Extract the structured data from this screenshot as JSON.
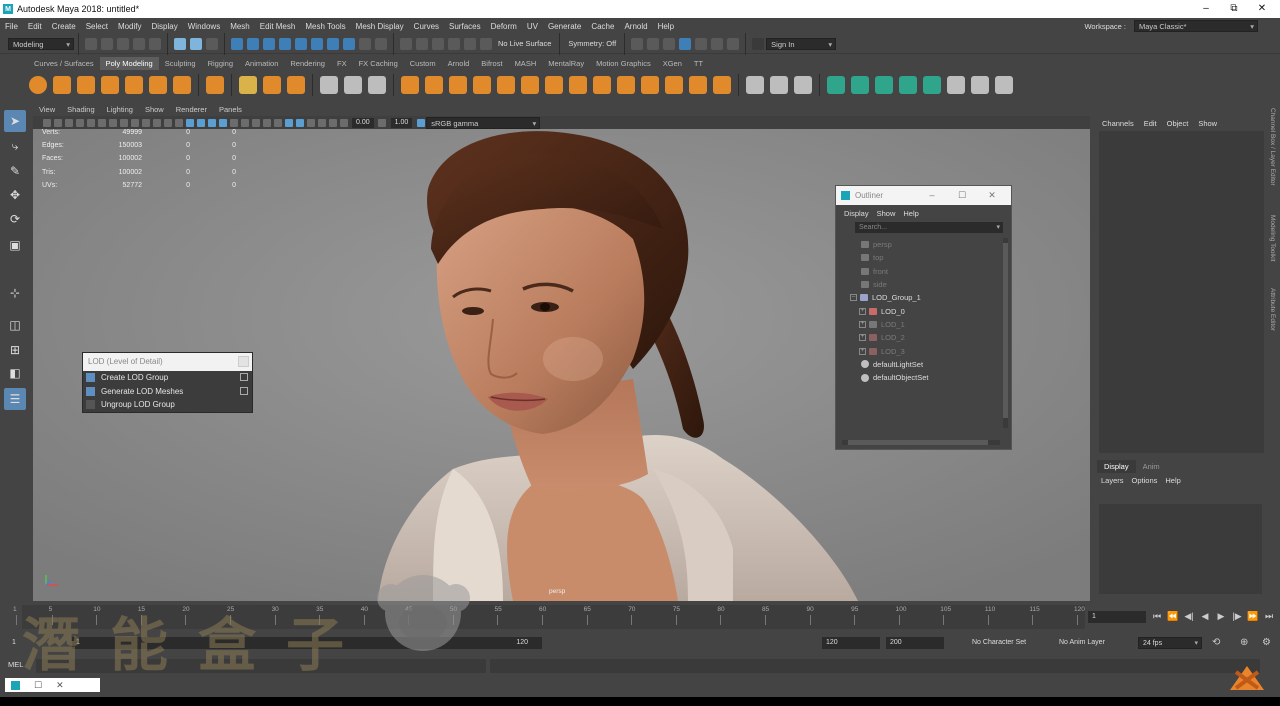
{
  "titlebar": {
    "title": "Autodesk Maya 2018: untitled*",
    "minimize": "–",
    "maximize": "⧉",
    "close": "✕"
  },
  "menubar": {
    "items": [
      "File",
      "Edit",
      "Create",
      "Select",
      "Modify",
      "Display",
      "Windows",
      "Mesh",
      "Edit Mesh",
      "Mesh Tools",
      "Mesh Display",
      "Curves",
      "Surfaces",
      "Deform",
      "UV",
      "Generate",
      "Cache",
      "Arnold",
      "Help"
    ],
    "workspace_label": "Workspace :",
    "workspace_value": "Maya Classic*"
  },
  "statusline": {
    "mode": "Modeling",
    "live_surface": "No Live Surface",
    "symmetry": "Symmetry: Off",
    "sign_in": "Sign In"
  },
  "shelf_tabs": [
    "Curves / Surfaces",
    "Poly Modeling",
    "Sculpting",
    "Rigging",
    "Animation",
    "Rendering",
    "FX",
    "FX Caching",
    "Custom",
    "Arnold",
    "Bifrost",
    "MASH",
    "MentalRay",
    "Motion Graphics",
    "XGen",
    "TT"
  ],
  "viewport": {
    "menu": [
      "View",
      "Shading",
      "Lighting",
      "Show",
      "Renderer",
      "Panels"
    ],
    "field1": "0.00",
    "field2": "1.00",
    "color_space": "sRGB gamma",
    "camera_label": "persp",
    "hud": [
      {
        "label": "Verts:",
        "v1": "49999",
        "v2": "0",
        "v3": "0"
      },
      {
        "label": "Edges:",
        "v1": "150003",
        "v2": "0",
        "v3": "0"
      },
      {
        "label": "Faces:",
        "v1": "100002",
        "v2": "0",
        "v3": "0"
      },
      {
        "label": "Tris:",
        "v1": "100002",
        "v2": "0",
        "v3": "0"
      },
      {
        "label": "UVs:",
        "v1": "52772",
        "v2": "0",
        "v3": "0"
      }
    ]
  },
  "lod_panel": {
    "title": "LOD (Level of Detail)",
    "items": [
      "Create LOD Group",
      "Generate LOD Meshes",
      "Ungroup LOD Group"
    ]
  },
  "outliner": {
    "title": "Outliner",
    "menu": [
      "Display",
      "Show",
      "Help"
    ],
    "search_placeholder": "Search...",
    "nodes": [
      {
        "label": "persp"
      },
      {
        "label": "top"
      },
      {
        "label": "front"
      },
      {
        "label": "side"
      },
      {
        "label": "LOD_Group_1"
      },
      {
        "label": "LOD_0"
      },
      {
        "label": "LOD_1"
      },
      {
        "label": "LOD_2"
      },
      {
        "label": "LOD_3"
      },
      {
        "label": "defaultLightSet"
      },
      {
        "label": "defaultObjectSet"
      }
    ]
  },
  "channelbox": {
    "menu": [
      "Channels",
      "Edit",
      "Object",
      "Show"
    ]
  },
  "layer_panel": {
    "tabs": [
      "Display",
      "Anim"
    ],
    "menu": [
      "Layers",
      "Options",
      "Help"
    ]
  },
  "side_tabs": [
    "Channel Box / Layer Editor",
    "Modeling Toolkit",
    "Attribute Editor"
  ],
  "timeline": {
    "ticks": [
      "1",
      "5",
      "10",
      "15",
      "20",
      "25",
      "30",
      "35",
      "40",
      "45",
      "50",
      "55",
      "60",
      "65",
      "70",
      "75",
      "80",
      "85",
      "90",
      "95",
      "100",
      "105",
      "110",
      "115",
      "120"
    ],
    "current_frame": "1"
  },
  "range": {
    "start": "1",
    "inner_start": "1",
    "inner_end": "120",
    "end": "120",
    "anim_end": "200",
    "character_set": "No Character Set",
    "anim_layer": "No Anim Layer",
    "fps": "24 fps"
  },
  "cmdline": {
    "label": "MEL"
  },
  "watermark": {
    "text": "潛能盒子"
  }
}
